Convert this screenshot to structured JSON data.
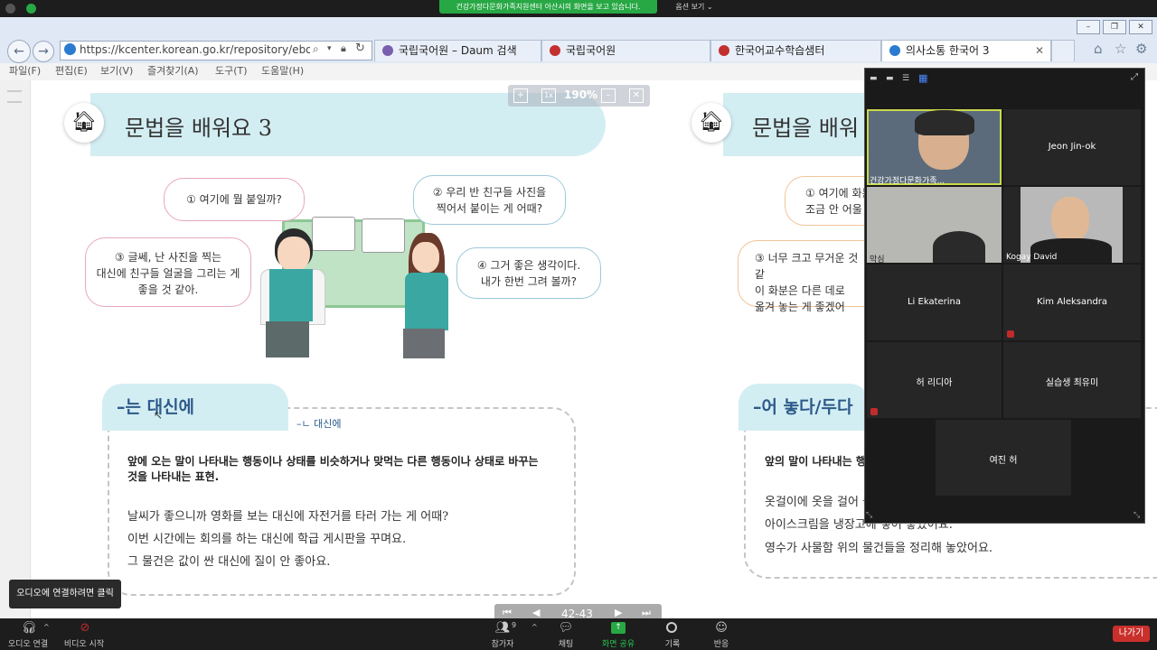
{
  "zoom_top": {
    "share_banner": "건강가정다문화가족지원센터 아산시의 화면을 보고 있습니다.",
    "view_options": "옵션 보기 ⌄"
  },
  "browser": {
    "address": "https://kcenter.korean.go.kr/repository/ebook/mid",
    "tabs": [
      {
        "label": "국립국어원 – Daum 검색",
        "icon_color": "#7a5fb0"
      },
      {
        "label": "국립국어원",
        "icon_color": "#c2312f"
      },
      {
        "label": "한국어교수학습샘터",
        "icon_color": "#c2312f"
      },
      {
        "label": "의사소통 한국어 3",
        "icon_color": "#2b7bd0"
      }
    ],
    "menu": [
      "파일(F)",
      "편집(E)",
      "보기(V)",
      "즐겨찾기(A)",
      "도구(T)",
      "도움말(H)"
    ]
  },
  "viewer": {
    "zoom_level": "190%",
    "zoom_reset": "1x",
    "page_indicator": "42-43"
  },
  "left_page": {
    "title": "문법을 배워요 3",
    "bubbles": [
      "① 여기에 뭘 붙일까?",
      "② 우리 반 친구들 사진을\n찍어서 붙이는 게 어때?",
      "③ 글쎄, 난 사진을 찍는\n대신에 친구들 얼굴을 그리는 게\n좋을 것 같아.",
      "④ 그거 좋은 생각이다.\n내가 한번 그려 볼까?"
    ],
    "grammar_header": "–는 대신에",
    "note": "–ㄴ 대신에",
    "definition": "앞에 오는 말이 나타내는 행동이나 상태를 비슷하거나 맞먹는 다른 행동이나 상태로 바꾸는 것을 나타내는 표현.",
    "examples": [
      "날씨가 좋으니까 영화를 보는 대신에 자전거를 타러 가는 게 어때?",
      "이번 시간에는 회의를 하는 대신에 학급 게시판을 꾸며요.",
      "그 물건은 값이 싼 대신에 질이 안 좋아요."
    ]
  },
  "right_page": {
    "title": "문법을 배워",
    "bubbles": [
      "① 여기에 화분\n조금 안 어울",
      "③ 너무 크고 무거운 것 같\n이 화분은 다른 데로\n옮겨 놓는 게 좋겠어"
    ],
    "grammar_header": "–어 놓다/두다",
    "definition": "앞의 말이 나타내는 행동",
    "examples": [
      "옷걸이에 옷을 걸어 놓",
      "아이스크림을 냉장고에 넣어 놓았어요.",
      "영수가 사물함 위의 물건들을 정리해 놓았어요."
    ]
  },
  "participants": [
    {
      "name": "건강가정다문화가족...",
      "video": true
    },
    {
      "name": "Jeon Jin-ok",
      "video": false
    },
    {
      "name": "막심",
      "video": true
    },
    {
      "name": "Kogay David",
      "video": true
    },
    {
      "name": "Li Ekaterina",
      "video": false
    },
    {
      "name": "Kim Aleksandra",
      "video": false
    },
    {
      "name": "허 리디아",
      "video": false
    },
    {
      "name": "실습생 최유미",
      "video": false
    },
    {
      "name": "여진 허",
      "video": false
    }
  ],
  "audio_tooltip": "오디오에 연결하려면 클릭",
  "toolbar": {
    "audio": "오디오 연결",
    "video": "비디오 시작",
    "participants": "참가자",
    "participants_count": "9",
    "chat": "채팅",
    "share": "화면 공유",
    "record": "기록",
    "reactions": "반응",
    "leave": "나가기"
  },
  "colors": {
    "share_green": "#27a844",
    "leave_red": "#c9302c",
    "title_band": "#d3eef3",
    "grammar_blue": "#2d5a8a"
  }
}
